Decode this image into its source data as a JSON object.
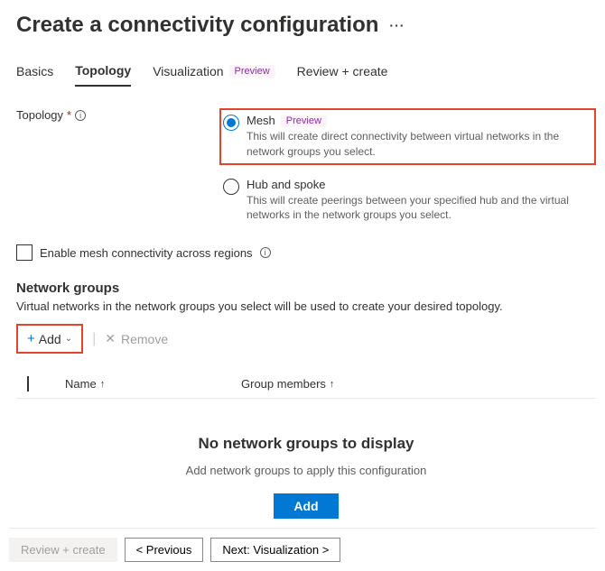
{
  "header": {
    "title": "Create a connectivity configuration",
    "ellipsis": "···"
  },
  "tabs": {
    "basics": "Basics",
    "topology": "Topology",
    "visualization": "Visualization",
    "visualization_badge": "Preview",
    "review": "Review + create"
  },
  "topology_field": {
    "label": "Topology",
    "required": "*",
    "info": "i"
  },
  "options": {
    "mesh": {
      "title": "Mesh",
      "badge": "Preview",
      "desc": "This will create direct connectivity between virtual networks in the network groups you select."
    },
    "hub": {
      "title": "Hub and spoke",
      "desc": "This will create peerings between your specified hub and the virtual networks in the network groups you select."
    }
  },
  "mesh_checkbox": {
    "label": "Enable mesh connectivity across regions",
    "info": "i"
  },
  "network_groups": {
    "header": "Network groups",
    "desc": "Virtual networks in the network groups you select will be used to create your desired topology.",
    "add_label": "Add",
    "remove_label": "Remove"
  },
  "table": {
    "name_header": "Name",
    "members_header": "Group members",
    "sort_arrow": "↑"
  },
  "empty": {
    "title": "No network groups to display",
    "desc": "Add network groups to apply this configuration",
    "add_label": "Add"
  },
  "footer": {
    "review": "Review + create",
    "previous": "< Previous",
    "next": "Next: Visualization >"
  }
}
